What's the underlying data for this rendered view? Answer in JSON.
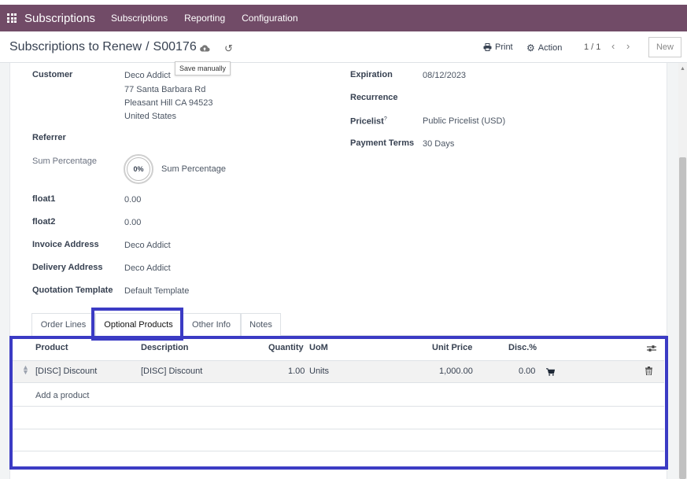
{
  "navbar": {
    "app_title": "Subscriptions",
    "menus": [
      "Subscriptions",
      "Reporting",
      "Configuration"
    ]
  },
  "control": {
    "breadcrumb_parent": "Subscriptions to Renew",
    "breadcrumb_separator": "/",
    "breadcrumb_current": "S00176",
    "save_tooltip": "Save manually",
    "print_label": "Print",
    "action_label": "Action",
    "pager": "1 / 1",
    "new_label": "New"
  },
  "form": {
    "customer_label": "Customer",
    "customer_name": "Deco Addict",
    "customer_street": "77 Santa Barbara Rd",
    "customer_city": "Pleasant Hill CA 94523",
    "customer_country": "United States",
    "referrer_label": "Referrer",
    "sum_percentage_label": "Sum Percentage",
    "sum_percentage_value": "0%",
    "sum_percentage_caption": "Sum Percentage",
    "float1_label": "float1",
    "float1_value": "0.00",
    "float2_label": "float2",
    "float2_value": "0.00",
    "invoice_address_label": "Invoice Address",
    "invoice_address_value": "Deco Addict",
    "delivery_address_label": "Delivery Address",
    "delivery_address_value": "Deco Addict",
    "quotation_template_label": "Quotation Template",
    "quotation_template_value": "Default Template",
    "expiration_label": "Expiration",
    "expiration_value": "08/12/2023",
    "recurrence_label": "Recurrence",
    "pricelist_label": "Pricelist",
    "pricelist_help": "?",
    "pricelist_value": "Public Pricelist (USD)",
    "payment_terms_label": "Payment Terms",
    "payment_terms_value": "30 Days"
  },
  "tabs": [
    "Order Lines",
    "Optional Products",
    "Other Info",
    "Notes"
  ],
  "table": {
    "headers": {
      "product": "Product",
      "description": "Description",
      "quantity": "Quantity",
      "uom": "UoM",
      "unit_price": "Unit Price",
      "discount": "Disc.%"
    },
    "rows": [
      {
        "product": "[DISC] Discount",
        "description": "[DISC] Discount",
        "quantity": "1.00",
        "uom": "Units",
        "unit_price": "1,000.00",
        "discount": "0.00"
      }
    ],
    "add_product_label": "Add a product"
  },
  "icons": {
    "apps": "apps-grid-icon",
    "save": "cloud-upload-icon",
    "discard": "undo-icon",
    "print": "printer-icon",
    "action": "gear-icon",
    "prev": "chevron-left-icon",
    "next": "chevron-right-icon",
    "optional_columns": "sliders-icon",
    "cart": "cart-icon",
    "delete": "trash-icon",
    "drag": "drag-handle-icon"
  },
  "colors": {
    "navbar": "#714b67",
    "highlight": "#3b3bc4"
  }
}
